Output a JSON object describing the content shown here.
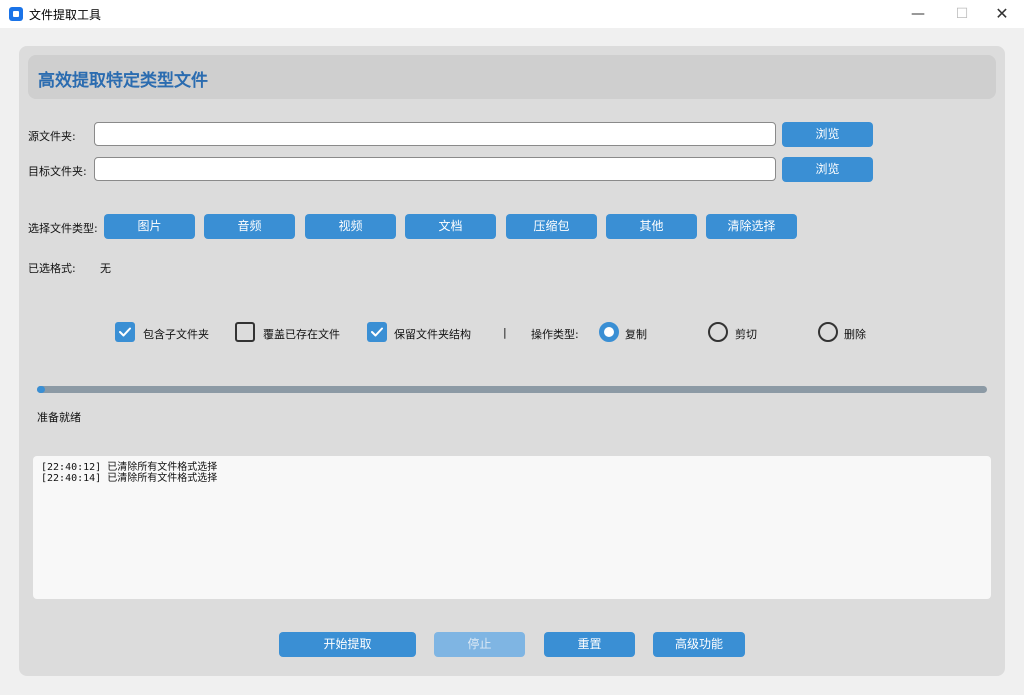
{
  "window": {
    "title": "文件提取工具",
    "minimize": "—",
    "maximize": "☐",
    "close": "✕"
  },
  "header": {
    "title": "高效提取特定类型文件"
  },
  "source": {
    "label": "源文件夹:",
    "value": "",
    "browse_label": "浏览"
  },
  "target": {
    "label": "目标文件夹:",
    "value": "",
    "browse_label": "浏览"
  },
  "file_types": {
    "label": "选择文件类型:",
    "buttons": [
      "图片",
      "音频",
      "视频",
      "文档",
      "压缩包",
      "其他",
      "清除选择"
    ]
  },
  "selected_formats": {
    "label": "已选格式:",
    "value": "无"
  },
  "options": {
    "include_subfolders": {
      "label": "包含子文件夹",
      "checked": true
    },
    "overwrite_existing": {
      "label": "覆盖已存在文件",
      "checked": false
    },
    "keep_structure": {
      "label": "保留文件夹结构",
      "checked": true
    },
    "separator": "|",
    "operation_label": "操作类型:",
    "operations": [
      {
        "label": "复制",
        "selected": true
      },
      {
        "label": "剪切",
        "selected": false
      },
      {
        "label": "删除",
        "selected": false
      }
    ]
  },
  "progress": {
    "percent": 0.8,
    "status": "准备就绪"
  },
  "log": {
    "lines": [
      "[22:40:12] 已清除所有文件格式选择",
      "[22:40:14] 已清除所有文件格式选择"
    ]
  },
  "actions": {
    "start": "开始提取",
    "stop": "停止",
    "reset": "重置",
    "advanced": "高级功能"
  },
  "colors": {
    "accent": "#3a8fd4",
    "header_text": "#2b6cb0"
  }
}
